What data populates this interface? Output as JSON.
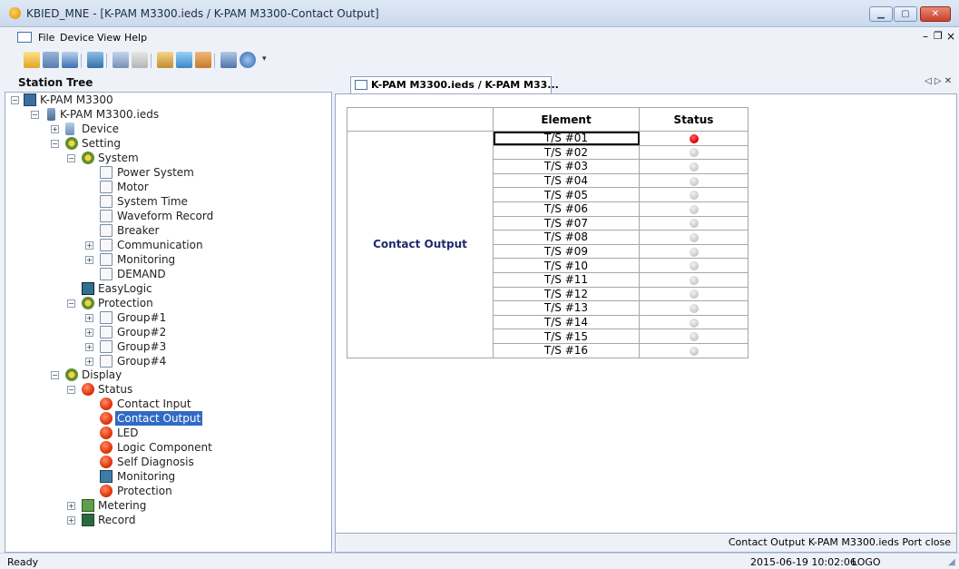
{
  "window": {
    "title": "KBIED_MNE - [K-PAM M3300.ieds / K-PAM M3300-Contact Output]"
  },
  "menu": [
    "File",
    "Device",
    "View",
    "Help"
  ],
  "station_tree": {
    "title": "Station Tree",
    "nodes": [
      {
        "label": "K-PAM M3300"
      },
      {
        "label": "K-PAM M3300.ieds"
      },
      {
        "label": "Device"
      },
      {
        "label": "Setting"
      },
      {
        "label": "System"
      },
      {
        "label": "Power System"
      },
      {
        "label": "Motor"
      },
      {
        "label": "System Time"
      },
      {
        "label": "Waveform Record"
      },
      {
        "label": "Breaker"
      },
      {
        "label": "Communication"
      },
      {
        "label": "Monitoring"
      },
      {
        "label": "DEMAND"
      },
      {
        "label": "EasyLogic"
      },
      {
        "label": "Protection"
      },
      {
        "label": "Group#1"
      },
      {
        "label": "Group#2"
      },
      {
        "label": "Group#3"
      },
      {
        "label": "Group#4"
      },
      {
        "label": "Display"
      },
      {
        "label": "Status"
      },
      {
        "label": "Contact Input"
      },
      {
        "label": "Contact Output",
        "selected": true
      },
      {
        "label": "LED"
      },
      {
        "label": "Logic Component"
      },
      {
        "label": "Self Diagnosis"
      },
      {
        "label": "Monitoring"
      },
      {
        "label": "Protection"
      },
      {
        "label": "Metering"
      },
      {
        "label": "Record"
      }
    ]
  },
  "document": {
    "tab_label": "K-PAM M3300.ieds / K-PAM M33...",
    "table": {
      "headers": [
        "",
        "Element",
        "Status"
      ],
      "row_label": "Contact Output",
      "rows": [
        {
          "element": "T/S #01",
          "status": "on"
        },
        {
          "element": "T/S #02",
          "status": "off"
        },
        {
          "element": "T/S #03",
          "status": "off"
        },
        {
          "element": "T/S #04",
          "status": "off"
        },
        {
          "element": "T/S #05",
          "status": "off"
        },
        {
          "element": "T/S #06",
          "status": "off"
        },
        {
          "element": "T/S #07",
          "status": "off"
        },
        {
          "element": "T/S #08",
          "status": "off"
        },
        {
          "element": "T/S #09",
          "status": "off"
        },
        {
          "element": "T/S #10",
          "status": "off"
        },
        {
          "element": "T/S #11",
          "status": "off"
        },
        {
          "element": "T/S #12",
          "status": "off"
        },
        {
          "element": "T/S #13",
          "status": "off"
        },
        {
          "element": "T/S #14",
          "status": "off"
        },
        {
          "element": "T/S #15",
          "status": "off"
        },
        {
          "element": "T/S #16",
          "status": "off"
        }
      ]
    },
    "status_text": "Contact Output  K-PAM M3300.ieds  Port close"
  },
  "statusbar": {
    "ready": "Ready",
    "datetime": "2015-06-19 10:02:06",
    "logo": "LOGO"
  },
  "colors": {
    "selection": "#316ac5",
    "led_on": "#e00000",
    "led_off": "#c8c8c8"
  }
}
